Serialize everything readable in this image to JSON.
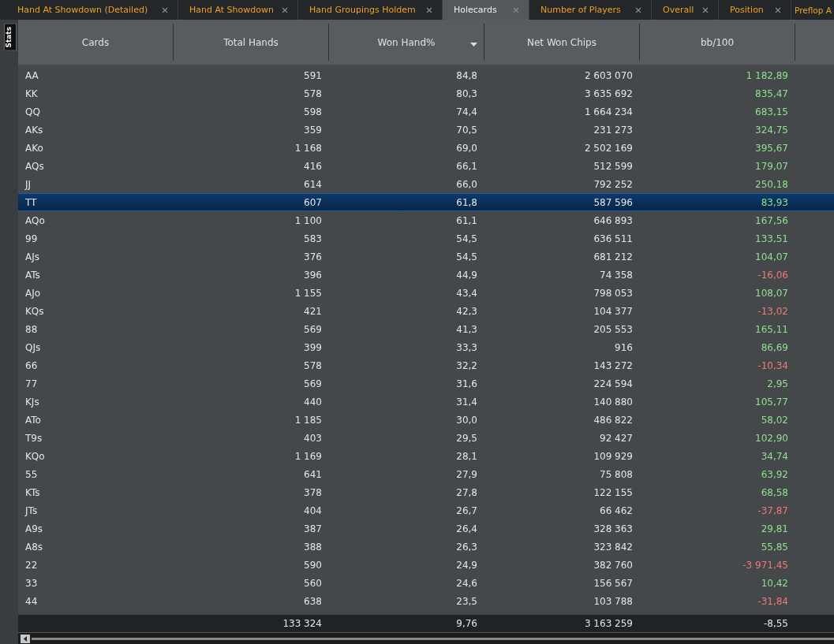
{
  "tabs": [
    {
      "label": "Hand At Showdown (Detailed)",
      "selected": false
    },
    {
      "label": "Hand At Showdown",
      "selected": false
    },
    {
      "label": "Hand Groupings Holdem",
      "selected": false
    },
    {
      "label": "Holecards",
      "selected": true
    },
    {
      "label": "Number of Players",
      "selected": false
    },
    {
      "label": "Overall",
      "selected": false
    },
    {
      "label": "Position",
      "selected": false
    },
    {
      "label": "Preflop A",
      "selected": false
    }
  ],
  "side_tab": "Stats",
  "table": {
    "columns": [
      {
        "label": "Cards",
        "sorted": false
      },
      {
        "label": "Total Hands",
        "sorted": false
      },
      {
        "label": "Won Hand%",
        "sorted": true
      },
      {
        "label": "Net Won Chips",
        "sorted": false
      },
      {
        "label": "bb/100",
        "sorted": false
      }
    ],
    "rows": [
      {
        "cards": "AA",
        "total": "591",
        "won": "84,8",
        "net": "2 603 070",
        "bb": "1 182,89",
        "color": "#8fe08f",
        "selected": false
      },
      {
        "cards": "KK",
        "total": "578",
        "won": "80,3",
        "net": "3 635 692",
        "bb": "835,47",
        "color": "#8fe08f",
        "selected": false
      },
      {
        "cards": "QQ",
        "total": "598",
        "won": "74,4",
        "net": "1 664 234",
        "bb": "683,15",
        "color": "#8fe08f",
        "selected": false
      },
      {
        "cards": "AKs",
        "total": "359",
        "won": "70,5",
        "net": "231 273",
        "bb": "324,75",
        "color": "#8fe08f",
        "selected": false
      },
      {
        "cards": "AKo",
        "total": "1 168",
        "won": "69,0",
        "net": "2 502 169",
        "bb": "395,67",
        "color": "#8fe08f",
        "selected": false
      },
      {
        "cards": "AQs",
        "total": "416",
        "won": "66,1",
        "net": "512 599",
        "bb": "179,07",
        "color": "#8fe08f",
        "selected": false
      },
      {
        "cards": "JJ",
        "total": "614",
        "won": "66,0",
        "net": "792 252",
        "bb": "250,18",
        "color": "#8fe08f",
        "selected": false
      },
      {
        "cards": "TT",
        "total": "607",
        "won": "61,8",
        "net": "587 596",
        "bb": "83,93",
        "color": "#8fe08f",
        "selected": true
      },
      {
        "cards": "AQo",
        "total": "1 100",
        "won": "61,1",
        "net": "646 893",
        "bb": "167,56",
        "color": "#8fe08f",
        "selected": false
      },
      {
        "cards": "99",
        "total": "583",
        "won": "54,5",
        "net": "636 511",
        "bb": "133,51",
        "color": "#8fe08f",
        "selected": false
      },
      {
        "cards": "AJs",
        "total": "376",
        "won": "54,5",
        "net": "681 212",
        "bb": "104,07",
        "color": "#8fe08f",
        "selected": false
      },
      {
        "cards": "ATs",
        "total": "396",
        "won": "44,9",
        "net": "74 358",
        "bb": "-16,06",
        "color": "#f07878",
        "selected": false
      },
      {
        "cards": "AJo",
        "total": "1 155",
        "won": "43,4",
        "net": "798 053",
        "bb": "108,07",
        "color": "#8fe08f",
        "selected": false
      },
      {
        "cards": "KQs",
        "total": "421",
        "won": "42,3",
        "net": "104 377",
        "bb": "-13,02",
        "color": "#f07878",
        "selected": false
      },
      {
        "cards": "88",
        "total": "569",
        "won": "41,3",
        "net": "205 553",
        "bb": "165,11",
        "color": "#8fe08f",
        "selected": false
      },
      {
        "cards": "QJs",
        "total": "399",
        "won": "33,3",
        "net": "916",
        "bb": "86,69",
        "color": "#8fe08f",
        "selected": false
      },
      {
        "cards": "66",
        "total": "578",
        "won": "32,2",
        "net": "143 272",
        "bb": "-10,34",
        "color": "#f07878",
        "selected": false
      },
      {
        "cards": "77",
        "total": "569",
        "won": "31,6",
        "net": "224 594",
        "bb": "2,95",
        "color": "#8fe08f",
        "selected": false
      },
      {
        "cards": "KJs",
        "total": "440",
        "won": "31,4",
        "net": "140 880",
        "bb": "105,77",
        "color": "#8fe08f",
        "selected": false
      },
      {
        "cards": "ATo",
        "total": "1 185",
        "won": "30,0",
        "net": "486 822",
        "bb": "58,02",
        "color": "#8fe08f",
        "selected": false
      },
      {
        "cards": "T9s",
        "total": "403",
        "won": "29,5",
        "net": "92 427",
        "bb": "102,90",
        "color": "#8fe08f",
        "selected": false
      },
      {
        "cards": "KQo",
        "total": "1 169",
        "won": "28,1",
        "net": "109 929",
        "bb": "34,74",
        "color": "#8fe08f",
        "selected": false
      },
      {
        "cards": "55",
        "total": "641",
        "won": "27,9",
        "net": "75 808",
        "bb": "63,92",
        "color": "#8fe08f",
        "selected": false
      },
      {
        "cards": "KTs",
        "total": "378",
        "won": "27,8",
        "net": "122 155",
        "bb": "68,58",
        "color": "#8fe08f",
        "selected": false
      },
      {
        "cards": "JTs",
        "total": "404",
        "won": "26,7",
        "net": "66 462",
        "bb": "-37,87",
        "color": "#f07878",
        "selected": false
      },
      {
        "cards": "A9s",
        "total": "387",
        "won": "26,4",
        "net": "328 363",
        "bb": "29,81",
        "color": "#8fe08f",
        "selected": false
      },
      {
        "cards": "A8s",
        "total": "388",
        "won": "26,3",
        "net": "323 842",
        "bb": "55,85",
        "color": "#8fe08f",
        "selected": false
      },
      {
        "cards": "22",
        "total": "590",
        "won": "24,9",
        "net": "382 760",
        "bb": "-3 971,45",
        "color": "#f07878",
        "selected": false
      },
      {
        "cards": "33",
        "total": "560",
        "won": "24,6",
        "net": "156 567",
        "bb": "10,42",
        "color": "#8fe08f",
        "selected": false
      },
      {
        "cards": "44",
        "total": "638",
        "won": "23,5",
        "net": "103 788",
        "bb": "-31,84",
        "color": "#f07878",
        "selected": false
      }
    ],
    "totals": {
      "total": "133 324",
      "won": "9,76",
      "net": "3 163 259",
      "bb": "-8,55"
    }
  }
}
